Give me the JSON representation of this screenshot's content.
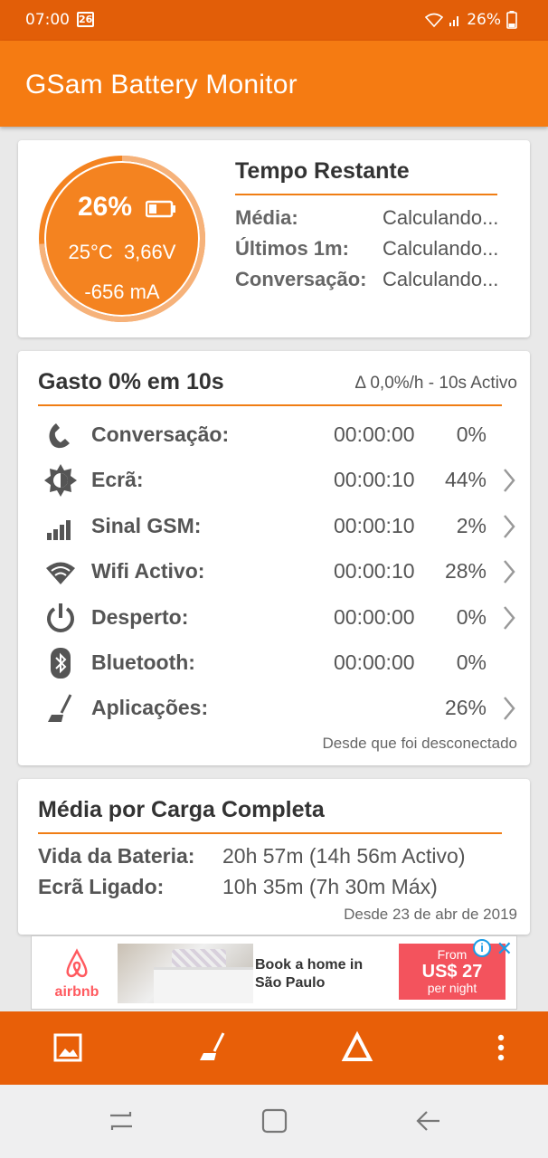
{
  "status_bar": {
    "time": "07:00",
    "date_badge": "26",
    "battery": "26%"
  },
  "app": {
    "title": "GSam Battery Monitor"
  },
  "battery_gauge": {
    "percent": "26%",
    "temperature": "25°C",
    "voltage": "3,66V",
    "current": "-656 mA",
    "level": 0.26
  },
  "time_remaining": {
    "title": "Tempo Restante",
    "rows": [
      {
        "label": "Média:",
        "value": "Calculando..."
      },
      {
        "label": "Últimos 1m:",
        "value": "Calculando..."
      },
      {
        "label": "Conversação:",
        "value": "Calculando..."
      }
    ]
  },
  "usage": {
    "title": "Gasto 0% em 10s",
    "delta": "Δ 0,0%/h - 10s Activo",
    "rows": [
      {
        "icon": "phone-icon",
        "name": "Conversação:",
        "time": "00:00:00",
        "pct": "0%",
        "chevron": false
      },
      {
        "icon": "screen-brightness-icon",
        "name": "Ecrã:",
        "time": "00:00:10",
        "pct": "44%",
        "chevron": true
      },
      {
        "icon": "signal-icon",
        "name": "Sinal GSM:",
        "time": "00:00:10",
        "pct": "2%",
        "chevron": true
      },
      {
        "icon": "wifi-icon",
        "name": "Wifi Activo:",
        "time": "00:00:10",
        "pct": "28%",
        "chevron": true
      },
      {
        "icon": "power-icon",
        "name": "Desperto:",
        "time": "00:00:00",
        "pct": "0%",
        "chevron": true
      },
      {
        "icon": "bluetooth-icon",
        "name": "Bluetooth:",
        "time": "00:00:00",
        "pct": "0%",
        "chevron": false
      },
      {
        "icon": "apps-broom-icon",
        "name": "Aplicações:",
        "time": "",
        "pct": "26%",
        "chevron": true
      }
    ],
    "footer": "Desde que foi desconectado"
  },
  "full_charge": {
    "title": "Média por Carga Completa",
    "rows": [
      {
        "label": "Vida da Bateria:",
        "value": "20h 57m (14h 56m Activo)"
      },
      {
        "label": "Ecrã Ligado:",
        "value": "10h 35m (7h 30m Máx)"
      }
    ],
    "footer": "Desde 23 de abr de 2019"
  },
  "ad": {
    "brand": "airbnb",
    "text_line1": "Book a home in",
    "text_line2": "São Paulo",
    "price_from": "From",
    "price_amount": "US$ 27",
    "price_unit": "per night"
  },
  "colors": {
    "orange": "#f57b12",
    "dark_orange": "#e25e08",
    "accent_line": "#f07d14"
  }
}
